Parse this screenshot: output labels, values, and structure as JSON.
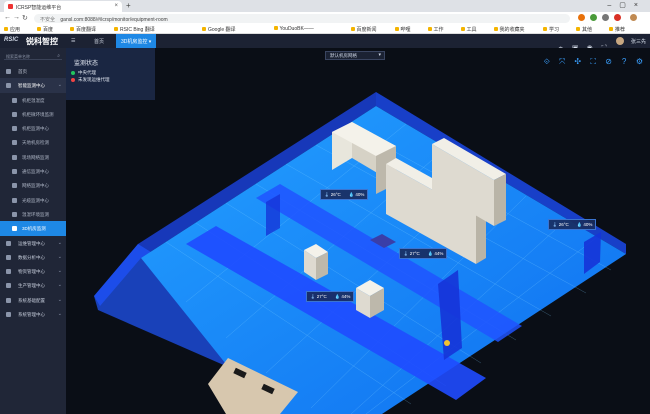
{
  "browser": {
    "tab_title": "ICRSP智能运维平台",
    "url_secure_label": "不安全",
    "url": "gansl.com:8088/#/icrsp/monitor/equipment-room",
    "bookmarks": [
      "应用",
      "百度",
      "百度翻译",
      "RSIC Bing 翻译",
      "Google 翻译",
      "YouDuoBK——",
      "百度新闻",
      "哔哩",
      "工作",
      "工具",
      "我的收藏夹",
      "学习",
      "其他",
      "推荐"
    ]
  },
  "app": {
    "brand_mark": "RSIC",
    "brand_name": "锐科智控",
    "tabs": {
      "home": "首页",
      "current": "3D机房监控"
    },
    "user_name": "张三先"
  },
  "sidebar": {
    "search_placeholder": "搜索菜单名称",
    "items": [
      {
        "label": "首页"
      },
      {
        "label": "智能监测中心"
      },
      {
        "label": "机柜温湿度"
      },
      {
        "label": "机柜微环境监测"
      },
      {
        "label": "机柜监测中心"
      },
      {
        "label": "天地机房检测"
      },
      {
        "label": "现场网络监测"
      },
      {
        "label": "通信监测中心"
      },
      {
        "label": "网络监测中心"
      },
      {
        "label": "光缆监测中心"
      },
      {
        "label": "温湿环境监测"
      },
      {
        "label": "3D机房监测"
      },
      {
        "label": "运维管理中心"
      },
      {
        "label": "数据分析中心"
      },
      {
        "label": "物资管理中心"
      },
      {
        "label": "生产管理中心"
      },
      {
        "label": "系统基础配置"
      },
      {
        "label": "系统管理中心"
      }
    ]
  },
  "scene": {
    "legend_title": "监测状态",
    "legend_items": [
      {
        "label": "中央代理",
        "color": "#22c55e"
      },
      {
        "label": "未发现运维代理",
        "color": "#ef4444"
      }
    ],
    "room_select": "默认机房网格",
    "readouts": [
      {
        "temp": "26°C",
        "hum": "40%"
      },
      {
        "temp": "26°C",
        "hum": "40%"
      },
      {
        "temp": "27°C",
        "hum": "44%"
      },
      {
        "temp": "27°C",
        "hum": "44%"
      }
    ]
  },
  "colors": {
    "accent": "#1e88e5",
    "floor": "#1c8cff",
    "wall": "#1f4bff"
  }
}
